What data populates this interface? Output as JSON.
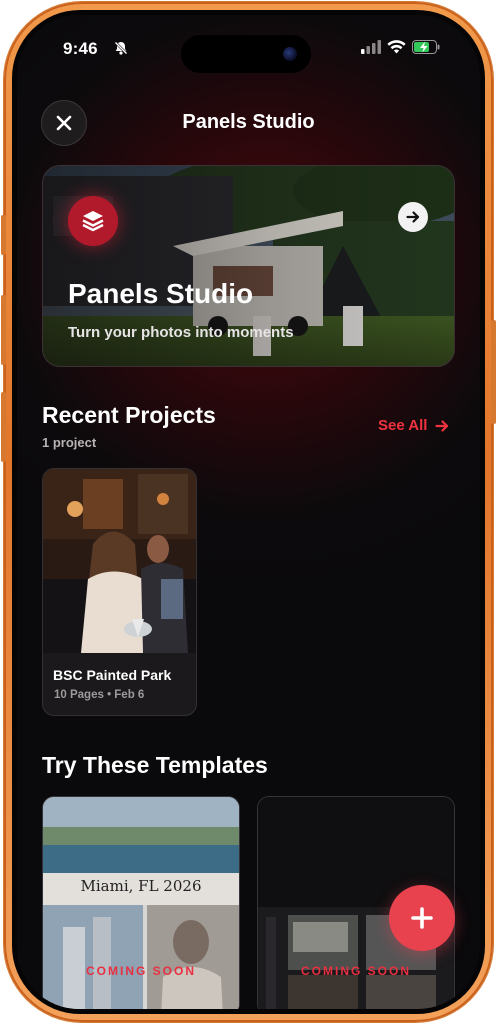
{
  "status_bar": {
    "time": "9:46",
    "icons": [
      "bell-slash-icon",
      "signal-icon",
      "wifi-icon",
      "battery-charging-icon"
    ]
  },
  "header": {
    "title": "Panels Studio",
    "close_icon": "close-icon"
  },
  "hero": {
    "title": "Panels Studio",
    "subtitle": "Turn your photos into moments",
    "logo_icon": "layers-icon",
    "arrow_icon": "arrow-right-icon"
  },
  "recent": {
    "title": "Recent Projects",
    "count": "1 project",
    "see_all": "See All",
    "projects": [
      {
        "name": "BSC Painted Park",
        "meta": "10 Pages • Feb 6"
      }
    ]
  },
  "templates": {
    "title": "Try These Templates",
    "items": [
      {
        "caption": "Miami, FL 2026",
        "badge": "COMING SOON"
      },
      {
        "badge": "COMING SOON"
      }
    ]
  },
  "fab": {
    "icon": "plus-icon"
  },
  "colors": {
    "accent": "#f0323f",
    "fab": "#e9424f",
    "frame": "#e8823a",
    "background": "#0a090b"
  }
}
